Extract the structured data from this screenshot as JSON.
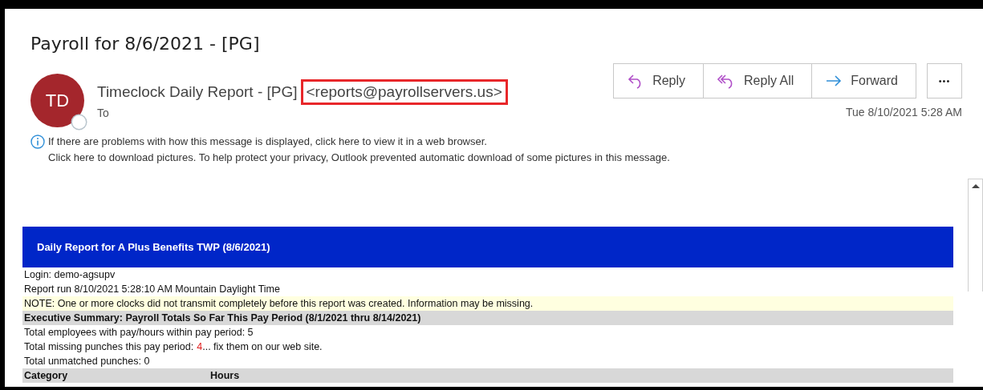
{
  "subject": "Payroll for 8/6/2021 - [PG]",
  "sender": {
    "initials": "TD",
    "name": "Timeclock Daily Report - [PG]",
    "email": "<reports@payrollservers.us>",
    "email_highlighted": true,
    "to_label": "To",
    "date": "Tue 8/10/2021 5:28 AM"
  },
  "actions": [
    {
      "kind": "reply",
      "label": "Reply"
    },
    {
      "kind": "reply_all",
      "label": "Reply All"
    },
    {
      "kind": "forward",
      "label": "Forward"
    }
  ],
  "more_button": "•••",
  "info_lines": [
    "If there are problems with how this message is displayed, click here to view it in a web browser.",
    "Click here to download pictures. To help protect your privacy, Outlook prevented automatic download of some pictures in this message."
  ],
  "report": {
    "title": "Daily Report for A Plus Benefits TWP (8/6/2021)",
    "lines": [
      {
        "kind": "plain",
        "text": "Login: demo-agsupv"
      },
      {
        "kind": "plain",
        "text": "Report run 8/10/2021 5:28:10 AM Mountain Daylight Time"
      },
      {
        "kind": "note",
        "text": "NOTE: One or more clocks did not transmit completely before this report was created. Information may be missing."
      },
      {
        "kind": "section",
        "text": "Executive Summary: Payroll Totals So Far This Pay Period (8/1/2021 thru 8/14/2021)"
      },
      {
        "kind": "plain",
        "text": "Total employees with pay/hours within pay period: 5"
      },
      {
        "kind": "count",
        "text": "Total missing punches this pay period:",
        "count": "4",
        "suffix": "... fix them on our web site."
      },
      {
        "kind": "plain",
        "text": "Total unmatched punches: 0"
      }
    ],
    "columns": [
      "Category",
      "Hours"
    ]
  }
}
